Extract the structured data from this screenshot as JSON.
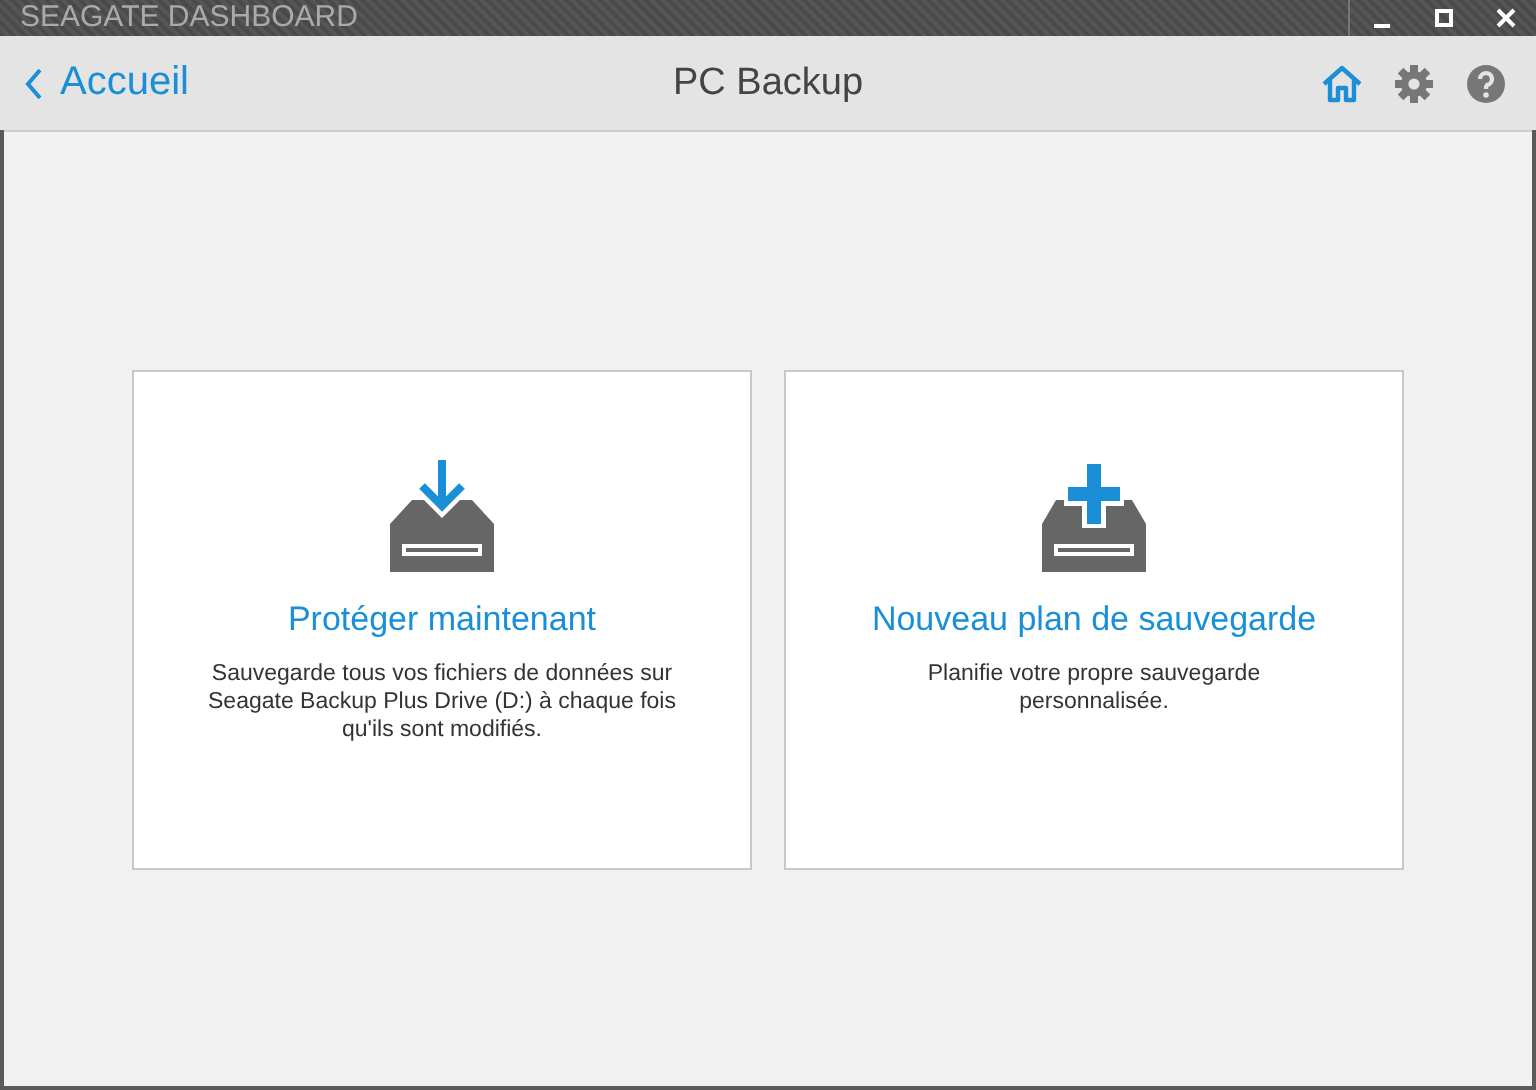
{
  "window": {
    "title": "SEAGATE DASHBOARD"
  },
  "header": {
    "back_label": "Accueil",
    "title": "PC Backup"
  },
  "cards": [
    {
      "kind": "download",
      "title": "Protéger maintenant",
      "description": "Sauvegarde tous vos fichiers de données sur Seagate Backup Plus Drive (D:) à chaque fois qu'ils sont modifiés."
    },
    {
      "kind": "add",
      "title": "Nouveau plan de sauvegarde",
      "description": "Planifie votre propre sauvegarde personnalisée."
    }
  ]
}
